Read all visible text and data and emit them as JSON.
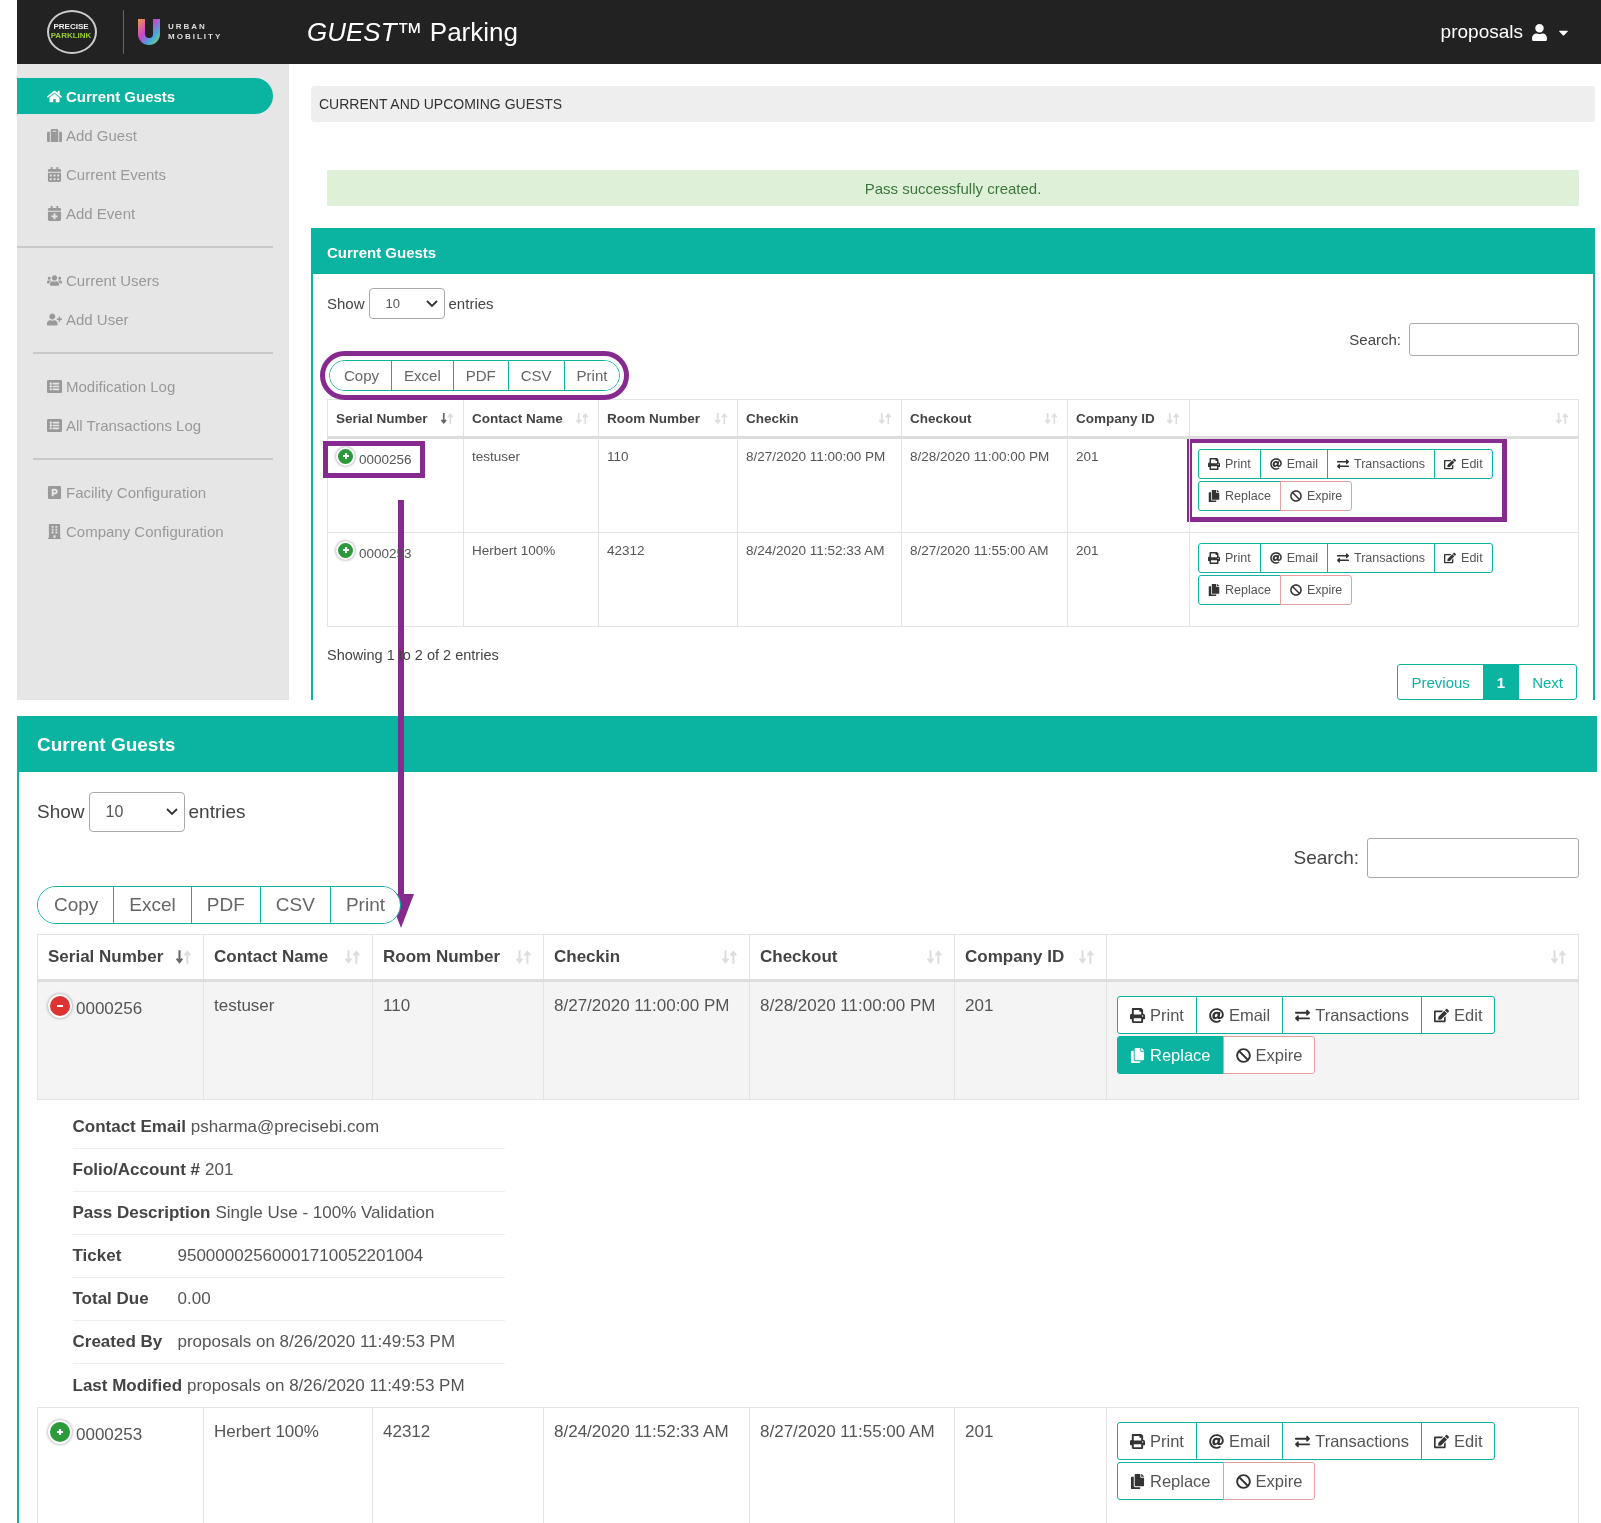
{
  "header": {
    "logos": [
      {
        "kind": "parklink",
        "lines": [
          "PRECISE",
          "PARKLINK"
        ]
      },
      {
        "kind": "urban",
        "lines": [
          "URBAN",
          "MOBILITY"
        ]
      }
    ],
    "title": "*GUEST*™ Parking",
    "user": "proposals"
  },
  "sidebar": {
    "groups": [
      [
        {
          "label": "Current Guests",
          "selected": true
        },
        {
          "label": "Add Guest",
          "selected": false
        },
        {
          "label": "Current Events",
          "selected": false
        },
        {
          "label": "Add Event",
          "selected": false
        }
      ],
      [
        {
          "label": "Current Users",
          "selected": false
        },
        {
          "label": "Add User",
          "selected": false
        }
      ],
      [
        {
          "label": "Modification Log",
          "selected": false
        },
        {
          "label": "All Transactions Log",
          "selected": false
        }
      ],
      [
        {
          "label": "Facility Configuration",
          "selected": false
        },
        {
          "label": "Company Configuration",
          "selected": false
        }
      ]
    ]
  },
  "page_heading": "CURRENT AND UPCOMING GUESTS",
  "alert": "Pass successfully created.",
  "panels": [
    {
      "title": "Current Guests",
      "show_label": "Show",
      "entries_value": "10",
      "entries_label": "entries",
      "search_label": "Search:",
      "export_highlighted": true,
      "export_buttons": [
        "Copy",
        "Excel",
        "PDF",
        "CSV",
        "Print"
      ],
      "columns": [
        {
          "label": "Serial Number",
          "sorted": true
        },
        {
          "label": "Contact Name",
          "sorted": false
        },
        {
          "label": "Room Number",
          "sorted": false
        },
        {
          "label": "Checkin",
          "sorted": false
        },
        {
          "label": "Checkout",
          "sorted": false
        },
        {
          "label": "Company ID",
          "sorted": false
        },
        {
          "sorted": false
        }
      ],
      "rows": [
        {
          "expanded": false,
          "serial_highlighted": true,
          "actions_highlighted": true,
          "cells": [
            "0000256",
            "testuser",
            "110",
            "8/27/2020 11:00:00 PM",
            "8/28/2020 11:00:00 PM",
            "201"
          ],
          "action_rows": [
            [
              {
                "label": "Print",
                "kind": "default",
                "selected": false
              },
              {
                "label": "Email",
                "kind": "default",
                "selected": false
              },
              {
                "label": "Transactions",
                "kind": "default",
                "selected": false
              },
              {
                "label": "Edit",
                "kind": "default",
                "selected": false
              }
            ],
            [
              {
                "label": "Replace",
                "kind": "default",
                "selected": false
              },
              {
                "label": "Expire",
                "kind": "danger",
                "selected": false
              }
            ]
          ]
        },
        {
          "expanded": false,
          "serial_highlighted": false,
          "actions_highlighted": false,
          "cells": [
            "0000253",
            "Herbert 100%",
            "42312",
            "8/24/2020 11:52:33 AM",
            "8/27/2020 11:55:00 AM",
            "201"
          ],
          "action_rows": [
            [
              {
                "label": "Print",
                "kind": "default",
                "selected": false
              },
              {
                "label": "Email",
                "kind": "default",
                "selected": false
              },
              {
                "label": "Transactions",
                "kind": "default",
                "selected": false
              },
              {
                "label": "Edit",
                "kind": "default",
                "selected": false
              }
            ],
            [
              {
                "label": "Replace",
                "kind": "default",
                "selected": false
              },
              {
                "label": "Expire",
                "kind": "danger",
                "selected": false
              }
            ]
          ]
        }
      ],
      "info": "Showing 1 to 2 of 2 entries",
      "pagination": [
        {
          "label": "Previous",
          "selected": false
        },
        {
          "label": "1",
          "selected": true
        },
        {
          "label": "Next",
          "selected": false
        }
      ]
    },
    {
      "title": "Current Guests",
      "show_label": "Show",
      "entries_value": "10",
      "entries_label": "entries",
      "search_label": "Search:",
      "export_highlighted": false,
      "export_buttons": [
        "Copy",
        "Excel",
        "PDF",
        "CSV",
        "Print"
      ],
      "columns": [
        {
          "label": "Serial Number",
          "sorted": true
        },
        {
          "label": "Contact Name",
          "sorted": false
        },
        {
          "label": "Room Number",
          "sorted": false
        },
        {
          "label": "Checkin",
          "sorted": false
        },
        {
          "label": "Checkout",
          "sorted": false
        },
        {
          "label": "Company ID",
          "sorted": false
        },
        {
          "sorted": false
        }
      ],
      "rows": [
        {
          "expanded": true,
          "serial_highlighted": false,
          "actions_highlighted": false,
          "cells": [
            "0000256",
            "testuser",
            "110",
            "8/27/2020 11:00:00 PM",
            "8/28/2020 11:00:00 PM",
            "201"
          ],
          "action_rows": [
            [
              {
                "label": "Print",
                "kind": "default",
                "selected": false
              },
              {
                "label": "Email",
                "kind": "default",
                "selected": false
              },
              {
                "label": "Transactions",
                "kind": "default",
                "selected": false
              },
              {
                "label": "Edit",
                "kind": "default",
                "selected": false
              }
            ],
            [
              {
                "label": "Replace",
                "kind": "default",
                "selected": true
              },
              {
                "label": "Expire",
                "kind": "danger",
                "selected": false
              }
            ]
          ],
          "details": [
            {
              "label": "Contact Email",
              "value": "psharma@precisebi.com"
            },
            {
              "label": "Folio/Account #",
              "value": "201"
            },
            {
              "label": "Pass Description",
              "value": "Single Use - 100% Validation"
            },
            {
              "label": "Ticket",
              "value": "95000002560001710052201004"
            },
            {
              "label": "Total Due",
              "value": "0.00"
            },
            {
              "label": "Created By",
              "value": "proposals on 8/26/2020 11:49:53 PM"
            },
            {
              "label": "Last Modified",
              "value": "proposals on 8/26/2020 11:49:53 PM"
            }
          ]
        },
        {
          "expanded": false,
          "serial_highlighted": false,
          "actions_highlighted": false,
          "cells": [
            "0000253",
            "Herbert 100%",
            "42312",
            "8/24/2020 11:52:33 AM",
            "8/27/2020 11:55:00 AM",
            "201"
          ],
          "action_rows": [
            [
              {
                "label": "Print",
                "kind": "default",
                "selected": false
              },
              {
                "label": "Email",
                "kind": "default",
                "selected": false
              },
              {
                "label": "Transactions",
                "kind": "default",
                "selected": false
              },
              {
                "label": "Edit",
                "kind": "default",
                "selected": false
              }
            ],
            [
              {
                "label": "Replace",
                "kind": "default",
                "selected": false
              },
              {
                "label": "Expire",
                "kind": "danger",
                "selected": false
              }
            ]
          ]
        }
      ]
    }
  ],
  "callout_arrow": true
}
